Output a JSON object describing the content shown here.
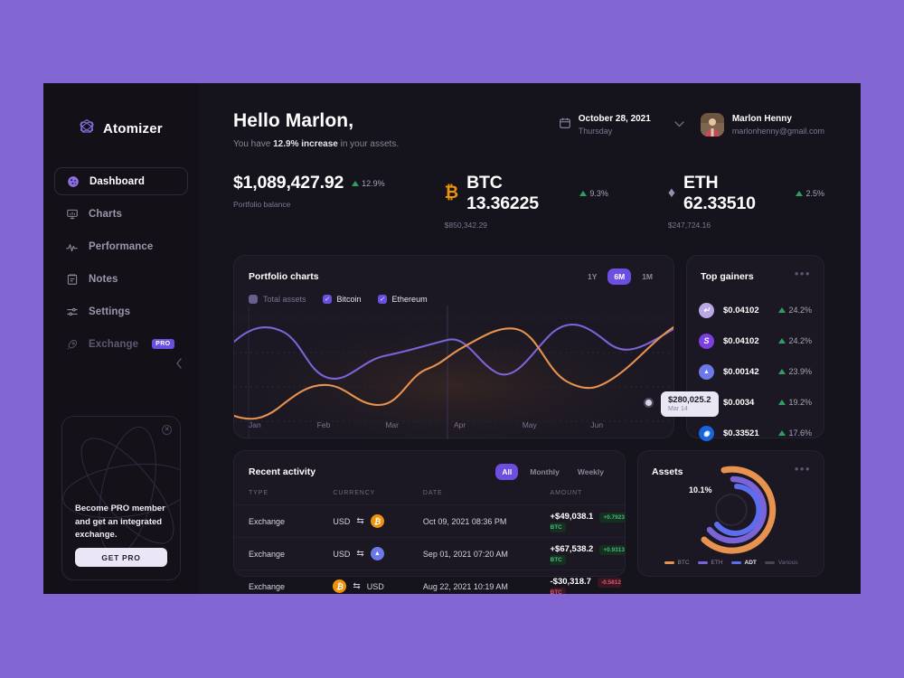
{
  "brand": {
    "name": "Atomizer",
    "icon": "atom-star-icon"
  },
  "sidebar": {
    "items": [
      {
        "label": "Dashboard",
        "icon": "dashboard-circle-icon",
        "active": true
      },
      {
        "label": "Charts",
        "icon": "chart-monitor-icon",
        "active": false
      },
      {
        "label": "Performance",
        "icon": "pulse-line-icon",
        "active": false
      },
      {
        "label": "Notes",
        "icon": "notepad-icon",
        "active": false
      },
      {
        "label": "Settings",
        "icon": "sliders-icon",
        "active": false
      },
      {
        "label": "Exchange",
        "icon": "rocket-icon",
        "active": false,
        "badge": "PRO",
        "dim": true
      }
    ],
    "collapse_icon": "chevron-left-icon",
    "promo": {
      "text": "Become PRO member and get an integrated exchange.",
      "button": "GET PRO",
      "close_icon": "close-circle-icon"
    }
  },
  "header": {
    "greeting": "Hello Marlon,",
    "sub_prefix": "You have ",
    "sub_strong": "12.9% increase",
    "sub_suffix": " in your assets.",
    "date": {
      "icon": "calendar-icon",
      "main": "October 28, 2021",
      "sub": "Thursday",
      "chevron": "chevron-down-icon"
    },
    "user": {
      "name": "Marlon Henny",
      "email": "marlonhenny@gmail.com",
      "avatar": "user-avatar"
    }
  },
  "stats": [
    {
      "symbol": "",
      "value": "$1,089,427.92",
      "delta": "12.9%",
      "dir": "up",
      "sub": "Portfolio balance"
    },
    {
      "symbol": "₿",
      "value": "BTC 13.36225",
      "delta": "9.3%",
      "dir": "up",
      "sub": "$850,342.29",
      "symbol_color": "#f0930a"
    },
    {
      "symbol": "♦",
      "value": "ETH 62.33510",
      "delta": "2.5%",
      "dir": "up",
      "sub": "$247,724.16",
      "symbol_color": "#8f93b0"
    }
  ],
  "portfolio": {
    "title": "Portfolio charts",
    "ranges": [
      {
        "label": "1Y",
        "active": false
      },
      {
        "label": "6M",
        "active": true
      },
      {
        "label": "1M",
        "active": false
      }
    ],
    "legend": [
      {
        "label": "Total assets",
        "checked": false,
        "color": "#6a5f8c"
      },
      {
        "label": "Bitcoin",
        "checked": true,
        "color": "#6c4ee0"
      },
      {
        "label": "Ethereum",
        "checked": true,
        "color": "#6c4ee0"
      }
    ],
    "tooltip": {
      "value": "$280,025.2",
      "date": "Mar 14"
    },
    "months": [
      "Jan",
      "Feb",
      "Mar",
      "Apr",
      "May",
      "Jun"
    ]
  },
  "chart_data": {
    "type": "line",
    "title": "Portfolio charts",
    "xlabel": "",
    "ylabel": "",
    "grid": true,
    "legend_position": "top-left",
    "x": [
      "Jan",
      "Feb",
      "Mar",
      "Apr",
      "May",
      "Jun"
    ],
    "series": [
      {
        "name": "Ethereum",
        "color": "#7b63d8",
        "values": [
          72,
          60,
          66,
          78,
          50,
          68
        ]
      },
      {
        "name": "Bitcoin",
        "color": "#e8924f",
        "values": [
          20,
          34,
          28,
          72,
          42,
          78
        ]
      }
    ],
    "annotation": {
      "label": "$280,025.2",
      "sublabel": "Mar 14",
      "x": "Mar 14",
      "series": "Ethereum"
    }
  },
  "gainers": {
    "title": "Top gainers",
    "menu_icon": "more-dots-icon",
    "rows": [
      {
        "icon": "coin-lavender-icon",
        "color": "#b9a7e8",
        "glyph": "↵",
        "price": "$0.04102",
        "pct": "24.2%",
        "dir": "up"
      },
      {
        "icon": "coin-purple-icon",
        "color": "#7b3fe4",
        "glyph": "S",
        "price": "$0.04102",
        "pct": "24.2%",
        "dir": "up"
      },
      {
        "icon": "coin-violet-icon",
        "color": "#6b7ae8",
        "glyph": "▲",
        "price": "$0.00142",
        "pct": "23.9%",
        "dir": "up"
      },
      {
        "icon": "coin-blue-icon",
        "color": "#2d6fd6",
        "glyph": "✒",
        "price": "$0.0034",
        "pct": "19.2%",
        "dir": "up"
      },
      {
        "icon": "coin-brightblue-icon",
        "color": "#1864de",
        "glyph": "◉",
        "price": "$0.33521",
        "pct": "17.6%",
        "dir": "up"
      }
    ]
  },
  "activity": {
    "title": "Recent activity",
    "filters": [
      {
        "label": "All",
        "active": true
      },
      {
        "label": "Monthly",
        "active": false
      },
      {
        "label": "Weekly",
        "active": false
      }
    ],
    "columns": [
      "TYPE",
      "CURRENCY",
      "DATE",
      "AMOUNT"
    ],
    "rows": [
      {
        "type": "Exchange",
        "from": "USD",
        "from_icon": "",
        "from_color": "",
        "to": "",
        "to_icon": "bitcoin-icon",
        "to_color": "#f0930a",
        "to_glyph": "₿",
        "swap_icon": "swap-arrows-icon",
        "date": "Oct 09, 2021 08:36 PM",
        "amount": "+$49,038.1",
        "badge": "+0.7923 BTC",
        "badge_dir": "up"
      },
      {
        "type": "Exchange",
        "from": "USD",
        "from_icon": "",
        "from_color": "",
        "to": "",
        "to_icon": "ethereum-icon",
        "to_color": "#6b7ae8",
        "to_glyph": "▲",
        "swap_icon": "swap-arrows-icon",
        "date": "Sep 01, 2021 07:20 AM",
        "amount": "+$67,538.2",
        "badge": "+0.9313 BTC",
        "badge_dir": "up"
      },
      {
        "type": "Exchange",
        "from": "",
        "from_icon": "bitcoin-icon",
        "from_color": "#f0930a",
        "from_glyph": "₿",
        "to": "USD",
        "to_icon": "",
        "to_color": "",
        "swap_icon": "swap-arrows-icon",
        "date": "Aug 22, 2021 10:19 AM",
        "amount": "-$30,318.7",
        "badge": "-0.5812 BTC",
        "badge_dir": "down"
      }
    ]
  },
  "assets": {
    "title": "Assets",
    "menu_icon": "more-dots-icon",
    "label": "10.1%",
    "legend": [
      {
        "label": "BTC",
        "color": "#e8924f"
      },
      {
        "label": "ETH",
        "color": "#7b63d8"
      },
      {
        "label": "ADT",
        "color": "#5b6ef0"
      },
      {
        "label": "Various",
        "color": "#4a4458"
      }
    ]
  }
}
